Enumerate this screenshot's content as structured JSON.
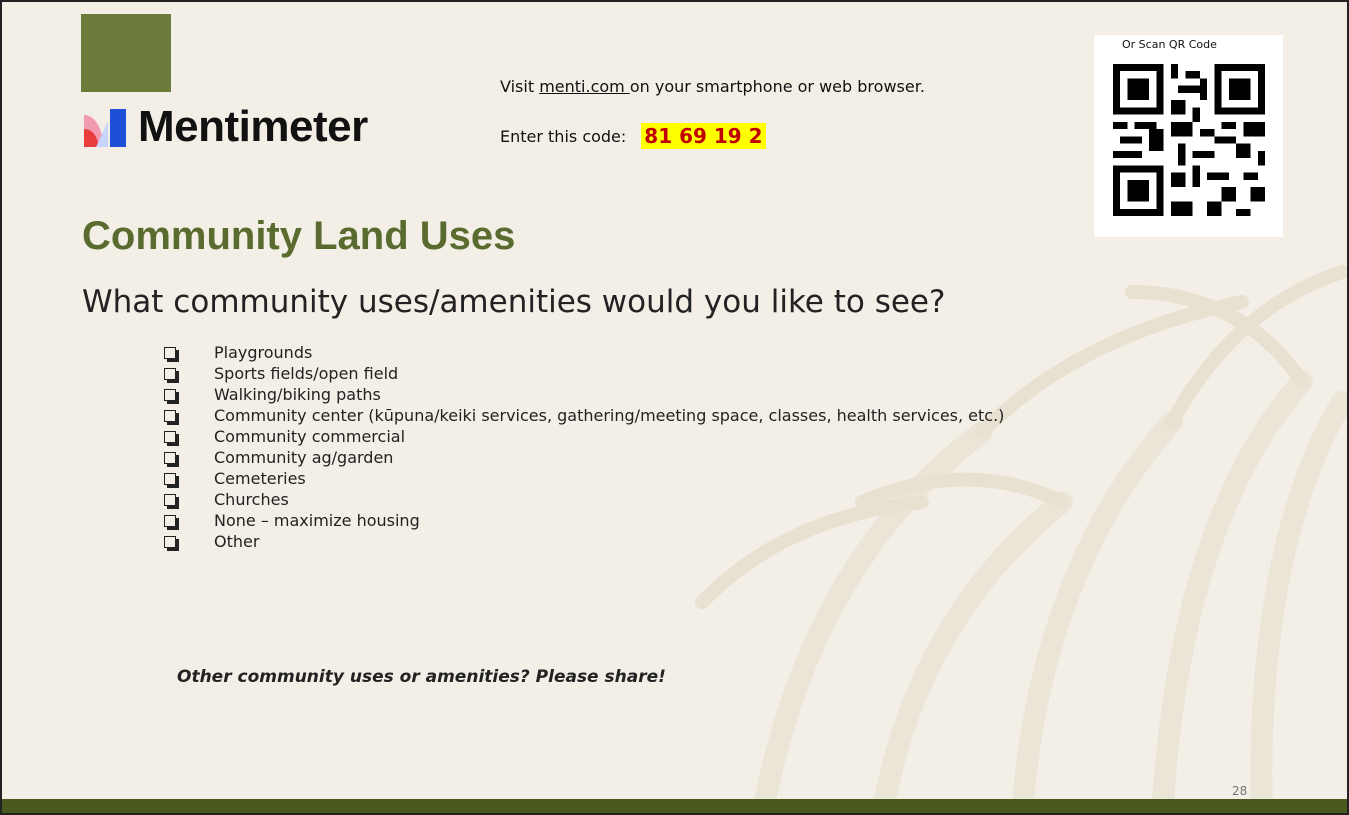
{
  "brand": {
    "logo_text": "Mentimeter"
  },
  "instructions": {
    "visit_prefix": "Visit ",
    "visit_link": "menti.com ",
    "visit_suffix": "on your smartphone or web browser.",
    "enter_label": "Enter this code:",
    "code": "81 69 19 2"
  },
  "qr": {
    "caption": "Or Scan QR Code",
    "icon": "qr-code-icon"
  },
  "slide": {
    "title": "Community Land Uses",
    "question": "What community uses/amenities would you like to see?",
    "options": [
      "Playgrounds",
      "Sports fields/open field",
      "Walking/biking paths",
      "Community center (kūpuna/keiki services, gathering/meeting space, classes, health services, etc.)",
      "Community commercial",
      "Community ag/garden",
      "Cemeteries",
      "Churches",
      "None – maximize housing",
      "Other"
    ],
    "prompt": "Other community uses or amenities? Please share!",
    "page_number": "28"
  },
  "colors": {
    "title": "#5a6b2f",
    "accent_block": "#6b7c3a",
    "footer": "#4a5a1e",
    "code_highlight": "#ffff00",
    "code_text": "#c00000"
  }
}
